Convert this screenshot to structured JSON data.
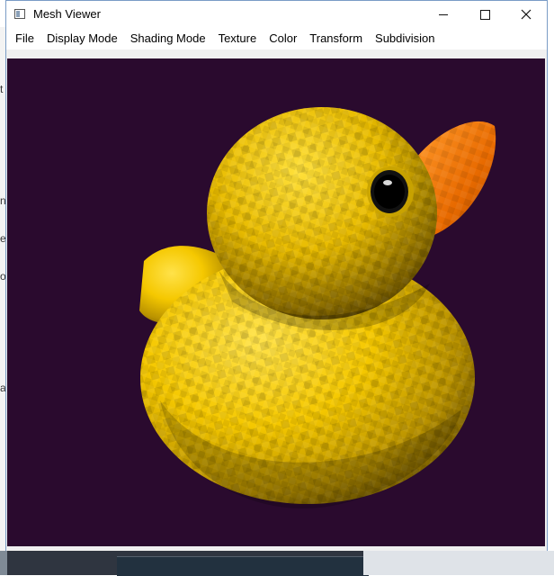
{
  "window": {
    "title": "Mesh Viewer"
  },
  "menu": {
    "items": [
      "File",
      "Display Mode",
      "Shading Mode",
      "Texture",
      "Color",
      "Transform",
      "Subdivision"
    ]
  },
  "viewport": {
    "background": "#2a0a2e",
    "model": "rubber-duck",
    "colors": {
      "body": "#f5c800",
      "body_shadow": "#9a7a00",
      "beak": "#ff8a1a",
      "eye": "#000000"
    }
  },
  "icons": [
    "app-icon",
    "minimize-icon",
    "maximize-icon",
    "close-icon"
  ]
}
